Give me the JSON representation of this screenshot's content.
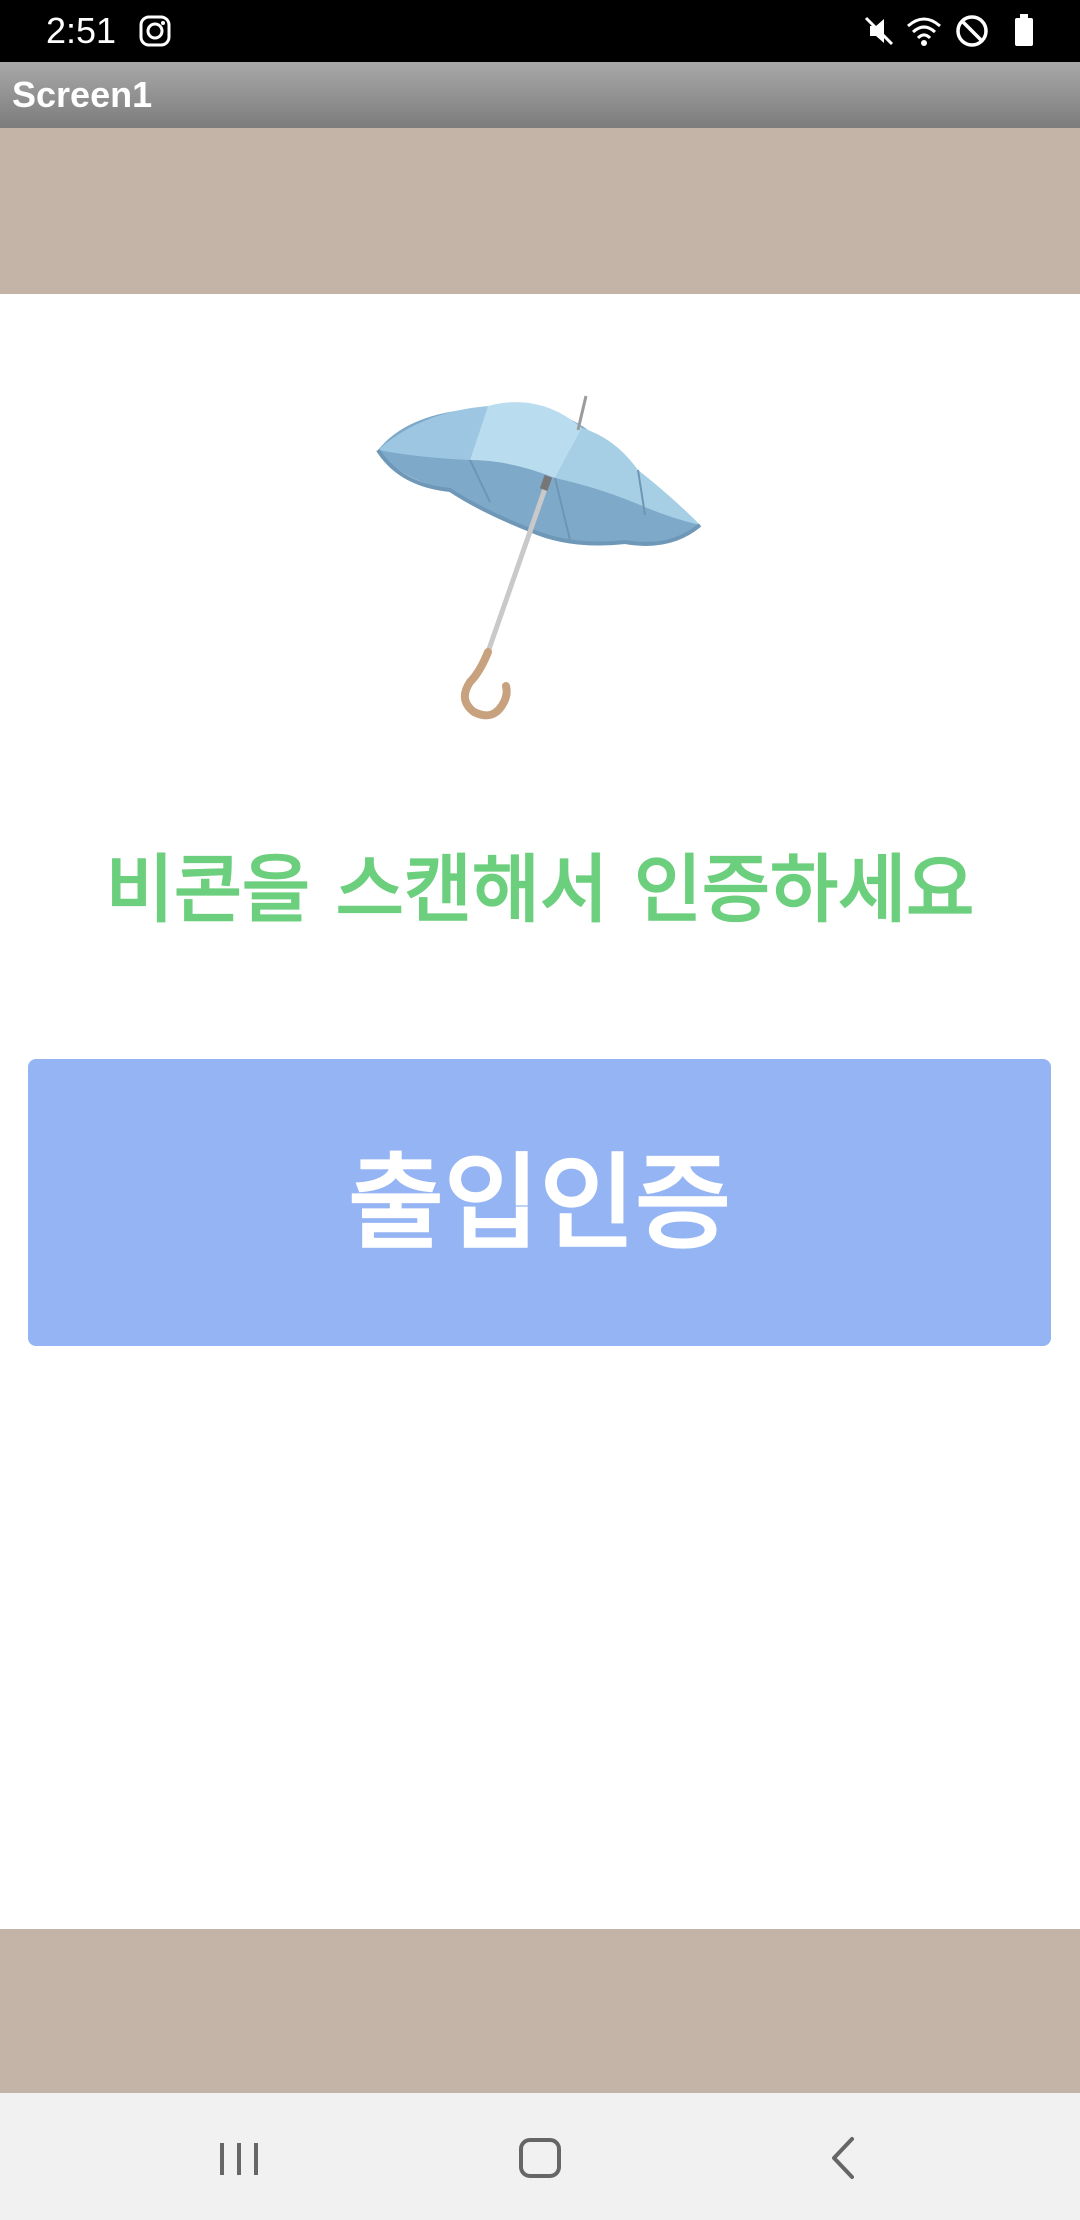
{
  "status_bar": {
    "time": "2:51",
    "icons": [
      "instagram-icon",
      "mute-icon",
      "wifi-icon",
      "do-not-disturb-icon",
      "battery-icon"
    ]
  },
  "app_bar": {
    "title": "Screen1"
  },
  "main": {
    "image": "umbrella-image",
    "instruction": "비콘을 스캔해서 인증하세요",
    "button_label": "출입인증"
  },
  "colors": {
    "band": "#c4b3a7",
    "instruction_text": "#6ccf7e",
    "button_bg": "#95b4f3",
    "button_text": "#ffffff"
  },
  "nav_bar": {
    "icons": [
      "recent-apps-icon",
      "home-icon",
      "back-icon"
    ]
  }
}
